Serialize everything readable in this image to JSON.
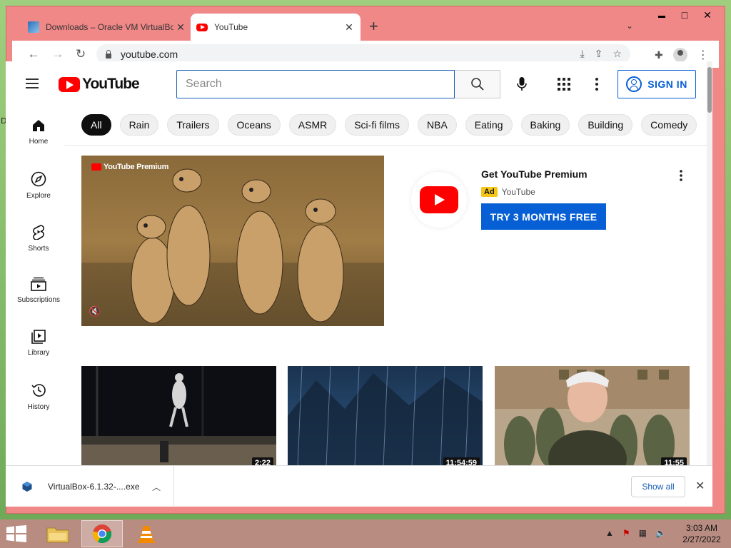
{
  "desktop": {
    "edge_char": "D"
  },
  "browser": {
    "tabs": [
      {
        "title": "Downloads – Oracle VM VirtualBox",
        "icon": "virtualbox-icon",
        "active": false
      },
      {
        "title": "YouTube",
        "icon": "youtube-icon",
        "active": true
      }
    ],
    "url": "youtube.com",
    "window_controls": {
      "minimize": "▬",
      "maximize": "□",
      "close": "✕"
    }
  },
  "youtube": {
    "logo_text": "YouTube",
    "search": {
      "placeholder": "Search",
      "value": ""
    },
    "signin_label": "SIGN IN",
    "sidebar": [
      {
        "label": "Home",
        "icon": "home-icon"
      },
      {
        "label": "Explore",
        "icon": "compass-icon"
      },
      {
        "label": "Shorts",
        "icon": "shorts-icon"
      },
      {
        "label": "Subscriptions",
        "icon": "subscriptions-icon"
      },
      {
        "label": "Library",
        "icon": "library-icon"
      },
      {
        "label": "History",
        "icon": "history-icon"
      }
    ],
    "chips": [
      "All",
      "Rain",
      "Trailers",
      "Oceans",
      "ASMR",
      "Sci-fi films",
      "NBA",
      "Eating",
      "Baking",
      "Building",
      "Comedy"
    ],
    "ad": {
      "video_label": "YouTube Premium",
      "title": "Get YouTube Premium",
      "badge": "Ad",
      "channel": "YouTube",
      "cta": "TRY 3 MONTHS FREE"
    },
    "videos": [
      {
        "duration": "2:22"
      },
      {
        "duration": "11:54:59"
      },
      {
        "duration": "11:55"
      }
    ]
  },
  "downloads": {
    "file": "VirtualBox-6.1.32-....exe",
    "show_all": "Show all"
  },
  "taskbar": {
    "time": "3:03 AM",
    "date": "2/27/2022"
  },
  "colors": {
    "window_frame": "#f08888",
    "youtube_red": "#ff0000",
    "link_blue": "#065fd4",
    "taskbar": "#b98c82"
  }
}
